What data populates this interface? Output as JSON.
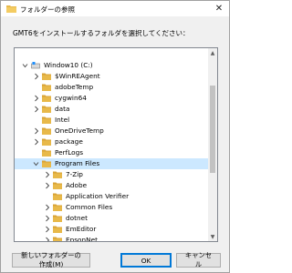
{
  "window": {
    "title": "フォルダーの参照",
    "close_glyph": "✕"
  },
  "instruction": "GMT6をインストールするフォルダを選択してください：",
  "colors": {
    "folder": "#e8b94a",
    "folder_dark": "#d9a336",
    "selection": "#cce8ff",
    "primary_border": "#0078d7"
  },
  "tree": {
    "items": [
      {
        "label": "",
        "level": 0,
        "chevron": "none",
        "icon": "none"
      },
      {
        "label": "Window10 (C:)",
        "level": 0,
        "chevron": "down",
        "icon": "drive"
      },
      {
        "label": "$WinREAgent",
        "level": 1,
        "chevron": "right",
        "icon": "folder"
      },
      {
        "label": "adobeTemp",
        "level": 1,
        "chevron": "none",
        "icon": "folder"
      },
      {
        "label": "cygwin64",
        "level": 1,
        "chevron": "right",
        "icon": "folder"
      },
      {
        "label": "data",
        "level": 1,
        "chevron": "right",
        "icon": "folder"
      },
      {
        "label": "Intel",
        "level": 1,
        "chevron": "none",
        "icon": "folder"
      },
      {
        "label": "OneDriveTemp",
        "level": 1,
        "chevron": "right",
        "icon": "folder"
      },
      {
        "label": "package",
        "level": 1,
        "chevron": "right",
        "icon": "folder"
      },
      {
        "label": "PerfLogs",
        "level": 1,
        "chevron": "none",
        "icon": "folder"
      },
      {
        "label": "Program Files",
        "level": 1,
        "chevron": "down",
        "icon": "folder",
        "selected": true
      },
      {
        "label": "7-Zip",
        "level": 2,
        "chevron": "right",
        "icon": "folder"
      },
      {
        "label": "Adobe",
        "level": 2,
        "chevron": "right",
        "icon": "folder"
      },
      {
        "label": "Application Verifier",
        "level": 2,
        "chevron": "none",
        "icon": "folder"
      },
      {
        "label": "Common Files",
        "level": 2,
        "chevron": "right",
        "icon": "folder"
      },
      {
        "label": "dotnet",
        "level": 2,
        "chevron": "right",
        "icon": "folder"
      },
      {
        "label": "EmEditor",
        "level": 2,
        "chevron": "right",
        "icon": "folder"
      },
      {
        "label": "EpsonNet",
        "level": 2,
        "chevron": "right",
        "icon": "folder"
      }
    ]
  },
  "buttons": {
    "new_folder": "新しいフォルダーの作成(M)",
    "ok": "OK",
    "cancel": "キャンセル"
  }
}
